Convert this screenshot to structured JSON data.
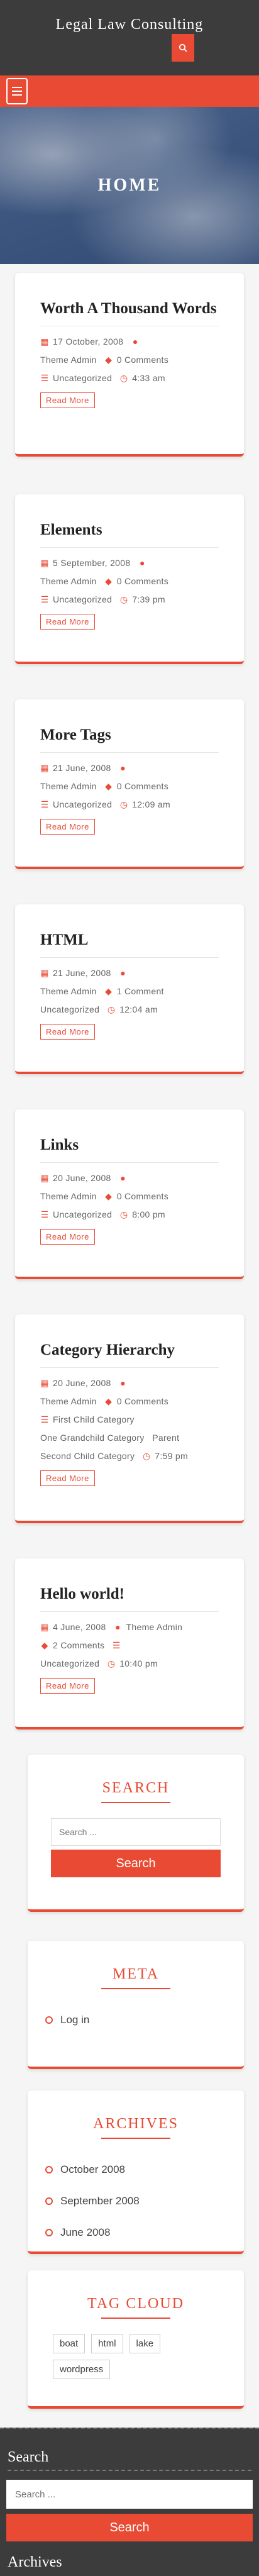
{
  "site": {
    "title": "Legal Law Consulting"
  },
  "hero": {
    "title": "HOME"
  },
  "posts": [
    {
      "title": "Worth A Thousand Words",
      "date": "17 October, 2008",
      "author": "Theme Admin",
      "comments": "0 Comments",
      "category": "Uncategorized",
      "time": "4:33 am",
      "read_more": "Read More"
    },
    {
      "title": "Elements",
      "date": "5 September, 2008",
      "author": "Theme Admin",
      "comments": "0 Comments",
      "category": "Uncategorized",
      "time": "7:39 pm",
      "read_more": "Read More"
    },
    {
      "title": "More Tags",
      "date": "21 June, 2008",
      "author": "Theme Admin",
      "comments": "0 Comments",
      "category": "Uncategorized",
      "time": "12:09 am",
      "read_more": "Read More"
    },
    {
      "title": "HTML",
      "date": "21 June, 2008",
      "author": "Theme Admin",
      "comments": "1 Comment",
      "category": "Uncategorized",
      "time": "12:04 am",
      "read_more": "Read More"
    },
    {
      "title": "Links",
      "date": "20 June, 2008",
      "author": "Theme Admin",
      "comments": "0 Comments",
      "category": "Uncategorized",
      "time": "8:00 pm",
      "read_more": "Read More"
    },
    {
      "title": "Category Hierarchy",
      "date": "20 June, 2008",
      "author": "Theme Admin",
      "comments": "0 Comments",
      "category1": "First Child Category",
      "category2": "One Grandchild Category",
      "category3": "Parent",
      "category4": "Second Child Category",
      "time": "7:59 pm",
      "read_more": "Read More"
    },
    {
      "title": "Hello world!",
      "date": "4 June, 2008",
      "author": "Theme Admin",
      "comments": "2 Comments",
      "category": "Uncategorized",
      "time": "10:40 pm",
      "read_more": "Read More"
    }
  ],
  "widgets": {
    "search": {
      "title": "SEARCH",
      "placeholder": "Search ...",
      "button": "Search"
    },
    "meta": {
      "title": "META",
      "items": [
        "Log in"
      ]
    },
    "archives": {
      "title": "ARCHIVES",
      "items": [
        "October 2008",
        "September 2008",
        "June 2008"
      ]
    },
    "tags": {
      "title": "TAG CLOUD",
      "items": [
        "boat",
        "html",
        "lake",
        "wordpress"
      ]
    }
  },
  "footer": {
    "search_title": "Search",
    "search_placeholder": "Search ...",
    "search_button": "Search",
    "archives_title": "Archives"
  },
  "colors": {
    "accent": "#e84a34",
    "header": "#3c3c3c"
  }
}
